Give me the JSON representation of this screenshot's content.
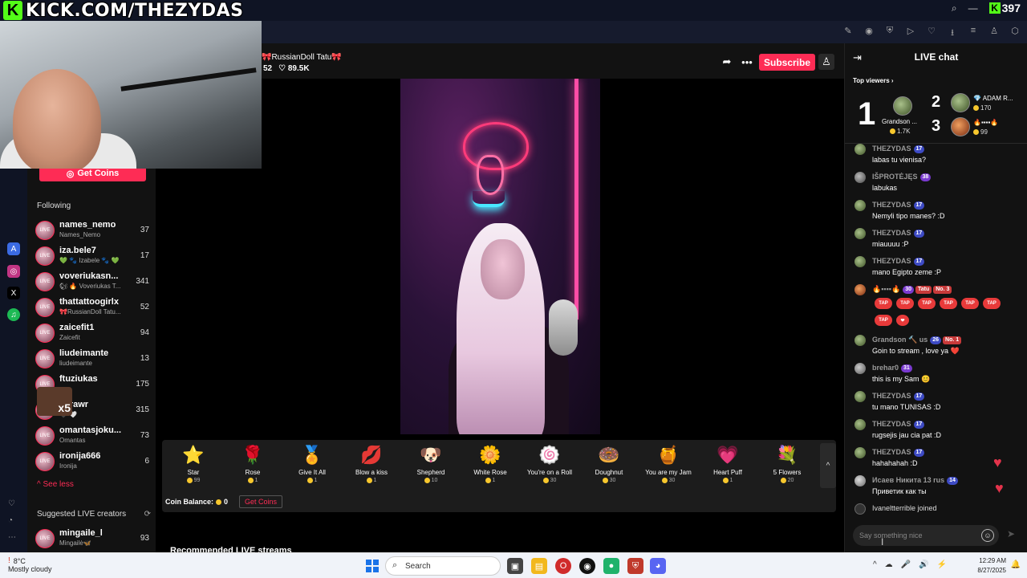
{
  "brand": {
    "k": "K",
    "text": "KICK.COM/THEZYDAS"
  },
  "top_right": {
    "search_icon": "⌕",
    "minimize_icon": "—",
    "counter_k": "K",
    "counter": "397"
  },
  "toolbar_icons": [
    "✎",
    "◉",
    "⛨",
    "▷",
    "♡",
    "⭳",
    "≡",
    "♙",
    "⬡"
  ],
  "webcam": {
    "label": "streamer webcam"
  },
  "rail_icons": [
    {
      "name": "app-icon",
      "glyph": "A",
      "color": "#3b6be3"
    },
    {
      "name": "instagram-icon",
      "glyph": "◎",
      "color": "#c13584"
    },
    {
      "name": "x-icon",
      "glyph": "X",
      "color": "#000000"
    },
    {
      "name": "spotify-icon",
      "glyph": "♫",
      "color": "#1db954"
    }
  ],
  "sidebar": {
    "get_coins": "Get Coins",
    "following_title": "Following",
    "following": [
      {
        "name": "names_nemo",
        "sub": "Names_Nemo",
        "count": "37"
      },
      {
        "name": "iza.bele7",
        "sub": "💚 🐾 Izabele 🐾 💚",
        "count": "17"
      },
      {
        "name": "voveriukasn...",
        "sub": "🐿 🔥 Voveriukas T...",
        "count": "341"
      },
      {
        "name": "thattattoogirlx",
        "sub": "🎀RussianDoll Tatu...",
        "count": "52"
      },
      {
        "name": "zaicefit1",
        "sub": "Zaicefit",
        "count": "94"
      },
      {
        "name": "liudeimante",
        "sub": "liudeimante",
        "count": "13"
      },
      {
        "name": "ftuziukas",
        "sub": "y",
        "count": "175"
      },
      {
        "name": "o_rawr",
        "sub": "🖤 🤍",
        "count": "315"
      },
      {
        "name": "omantasjoku...",
        "sub": "Omantas",
        "count": "73"
      },
      {
        "name": "ironija666",
        "sub": "Ironija",
        "count": "6"
      }
    ],
    "see_less": "See less",
    "suggested_title": "Suggested LIVE creators",
    "suggested": [
      {
        "name": "mingaile_l",
        "sub": "Mingailė🦋",
        "count": "93"
      }
    ],
    "sticker": "x5"
  },
  "stream": {
    "host_tag": "🎀RussianDoll Tatu🎀",
    "viewers": "52",
    "likes": "♡ 89.5K",
    "share_icon": "➦",
    "more_icon": "•••",
    "subscribe": "Subscribe",
    "profile_icon": "♙"
  },
  "gifts": [
    {
      "name": "Star",
      "price": "99",
      "icon": "⭐"
    },
    {
      "name": "Rose",
      "price": "1",
      "icon": "🌹"
    },
    {
      "name": "Give It All",
      "price": "1",
      "icon": "🏅"
    },
    {
      "name": "Blow a kiss",
      "price": "1",
      "icon": "💋"
    },
    {
      "name": "Shepherd",
      "price": "10",
      "icon": "🐶"
    },
    {
      "name": "White Rose",
      "price": "1",
      "icon": "🌼"
    },
    {
      "name": "You're on a Roll",
      "price": "30",
      "icon": "🍥"
    },
    {
      "name": "Doughnut",
      "price": "30",
      "icon": "🍩"
    },
    {
      "name": "You are my Jam",
      "price": "30",
      "icon": "🍯"
    },
    {
      "name": "Heart Puff",
      "price": "1",
      "icon": "💗"
    },
    {
      "name": "5 Flowers",
      "price": "20",
      "icon": "💐"
    }
  ],
  "gift_collapse": "^",
  "coin_balance": {
    "label": "Coin Balance:",
    "value": "0",
    "get": "Get Coins"
  },
  "recommended": "Recommended LIVE streams",
  "chat": {
    "title": "LIVE chat",
    "collapse_icon": "⇥",
    "top_viewers": "Top viewers ›",
    "ranks": [
      {
        "rank": "1",
        "name": "Grandson ...",
        "score": "1.7K"
      },
      {
        "rank": "2",
        "name": "💎 ADAM R...",
        "score": "170"
      },
      {
        "rank": "3",
        "name": "🔥▪▪▪▪🔥",
        "score": "99"
      }
    ],
    "messages": [
      {
        "user": "THEZYDAS",
        "badge": "17",
        "text": "labas tu vienisa?"
      },
      {
        "user": "IŠPROTĖJĘS",
        "badge": "38",
        "text": "labukas"
      },
      {
        "user": "THEZYDAS",
        "badge": "17",
        "text": "Nemyli tipo manes? :D"
      },
      {
        "user": "THEZYDAS",
        "badge": "17",
        "text": "miauuuu :P"
      },
      {
        "user": "THEZYDAS",
        "badge": "17",
        "text": "mano Egipto zeme :P"
      },
      {
        "user": "🔥▪▪▪▪🔥",
        "badge": "30",
        "text": ""
      },
      {
        "user": "Grandson 🔨 us",
        "badge": "26",
        "text": "Goin to stream , love ya ❤️"
      },
      {
        "user": "brehar0",
        "badge": "31",
        "text": "this is my Sam 😊"
      },
      {
        "user": "THEZYDAS",
        "badge": "17",
        "text": "tu mano TUNISAS :D"
      },
      {
        "user": "THEZYDAS",
        "badge": "17",
        "text": "rugsejis jau cia pat :D"
      },
      {
        "user": "THEZYDAS",
        "badge": "17",
        "text": "hahahahah :D"
      },
      {
        "user": "Исаев Никита 13 rus",
        "badge": "14",
        "text": "Приветик как ты"
      }
    ],
    "tap_label": "TAP",
    "joined_user": "Ivaneltterrible",
    "joined_text": "joined",
    "input_placeholder": "Say something nice",
    "emoji_icon": "☺",
    "send_icon": "➤"
  },
  "taskbar": {
    "temp": "8°C",
    "weather": "Mostly cloudy",
    "search": "Search",
    "time": "12:29 AM",
    "date": "8/27/2025",
    "tray_icons": [
      "^",
      "☁",
      "🎤",
      "🔊",
      "⚡"
    ],
    "notify_icon": "🔔"
  }
}
